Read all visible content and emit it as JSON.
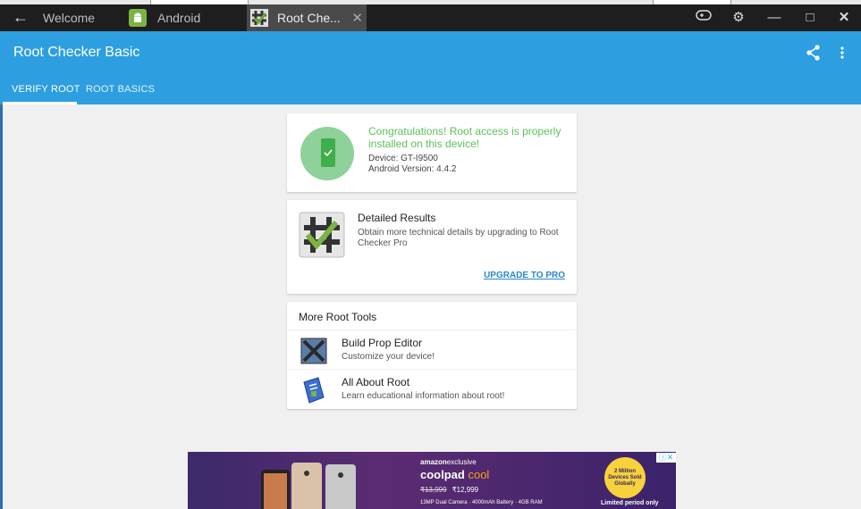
{
  "window": {
    "tabs": [
      {
        "label": "Welcome"
      },
      {
        "label": "Android"
      },
      {
        "label": "Root Che..."
      }
    ],
    "controls": [
      "gamepad-icon",
      "gear-icon",
      "minimize-icon",
      "maximize-icon",
      "close-icon"
    ]
  },
  "app": {
    "title": "Root Checker Basic",
    "tabs": [
      "VERIFY ROOT",
      "ROOT BASICS"
    ],
    "selected_tab": "VERIFY ROOT"
  },
  "status_card": {
    "message": "Congratulations! Root access is properly installed on this device!",
    "device": "Device: GT-I9500",
    "android_version": "Android Version: 4.4.2"
  },
  "details_card": {
    "title": "Detailed Results",
    "description": "Obtain more technical details by upgrading to Root Checker Pro",
    "action": "UPGRADE TO PRO"
  },
  "tools_card": {
    "title": "More Root Tools",
    "items": [
      {
        "title": "Build Prop Editor",
        "description": "Customize your device!"
      },
      {
        "title": "All About Root",
        "description": "Learn educational information about root!"
      }
    ]
  },
  "ad": {
    "brand_left": "amazon",
    "brand_right": "exclusive",
    "product": "coolpad",
    "product_suffix": "cool",
    "price_old": "₹13,999",
    "price_new": "₹12,999",
    "features": "13MP Dual Camera  ·  4000mAh Battery  ·  4GB RAM",
    "badge": "2 Million Devices Sold Globally",
    "limited": "Limited period only"
  },
  "colors": {
    "appbar": "#2d9fe0",
    "success": "#5cc05c",
    "link": "#2a87d0"
  }
}
